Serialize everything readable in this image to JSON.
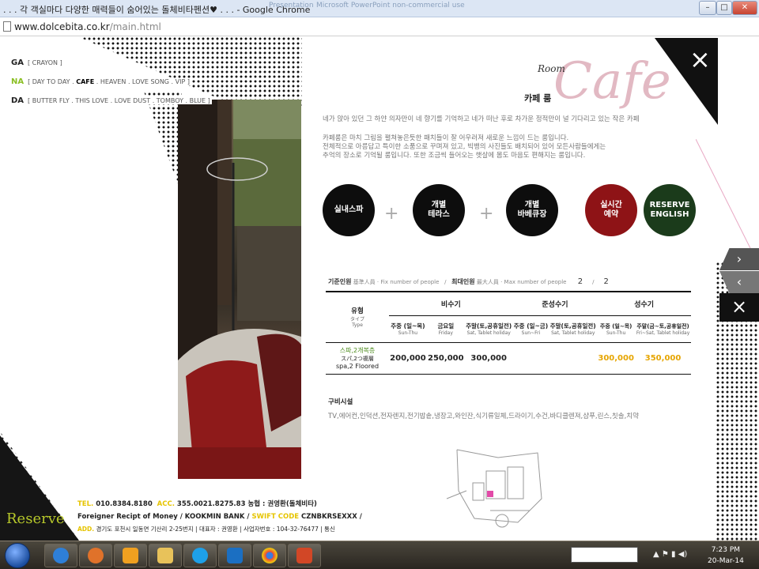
{
  "browser": {
    "title": ". . . 각 객실마다 다양한 매력들이 숨어있는 돌체비타펜션♥ . . . - Google Chrome",
    "url_host": "www.dolcebita.co.kr",
    "url_path": "/main.html",
    "window_buttons": {
      "minimize": "–",
      "maximize": "□",
      "close": "✕"
    }
  },
  "menu": [
    {
      "key": "GA",
      "items": [
        "CRAYON"
      ],
      "active": null
    },
    {
      "key": "NA",
      "items": [
        "DAY TO DAY",
        "CAFE",
        "HEAVEN",
        "LOVE SONG",
        "VIP"
      ],
      "active": "CAFE"
    },
    {
      "key": "DA",
      "items": [
        "BUTTER FLY",
        "THIS LOVE",
        "LOVE DUST",
        "TOMBOY",
        "BLUE"
      ],
      "active": null
    }
  ],
  "room": {
    "room_label": "Room",
    "script_title": "Cafe",
    "korean_title": "카페 룸",
    "close_icon": "×",
    "description_1": "네가 앉아 있던 그 하얀 의자만이 네 향기를 기억하고 네가 떠난 후로 차가운 정적만이 널 기다리고 있는 작은 카페",
    "description_2": [
      "카페룸은 마치 그림을 펼쳐놓은듯한 패치들이 잘 어우러져 새로운 느낌이 드는 룸입니다.",
      "전체적으로 아름답고 특이한 소품으로 꾸며져 있고, 빅뱅의 사진들도 배치되어 있어 모든사람들에게는",
      "추억의 장소로 기억될 룸입니다. 또한 조금씩 들어오는 햇살에 몸도 마음도 편해지는 룸입니다."
    ],
    "features": [
      {
        "label": "실내스파"
      },
      {
        "label": "개별\n테라스"
      },
      {
        "label": "개별\n바베큐장"
      }
    ],
    "buttons": {
      "realtime": "실시간\n예약",
      "reserve_en": "RESERVE\nENGLISH"
    }
  },
  "capacity": {
    "base_label": "기준인원",
    "base_sub": "基準人員 · Fix number of people",
    "max_label": "최대인원",
    "max_sub": "最大人員 · Max number of people",
    "base": "2",
    "max": "2",
    "sep": "/"
  },
  "rates": {
    "type_label": "유형",
    "type_sub1": "タイプ",
    "type_sub2": "Type",
    "seasons": [
      {
        "name": "비수기",
        "highlight": false
      },
      {
        "name": "준성수기",
        "highlight": false
      },
      {
        "name": "성수기",
        "highlight": false
      }
    ],
    "day_headers": [
      {
        "ko": "주중 (일~목)",
        "en": "Sun-Thu"
      },
      {
        "ko": "금요일",
        "en": "Friday"
      },
      {
        "ko": "주말(토,공휴일전)",
        "en": "Sat, Tablet holiday"
      },
      {
        "ko": "주중 (일~금)",
        "en": "Sun~Fri"
      },
      {
        "ko": "주말(토,공휴일전)",
        "en": "Sat, Tablet holiday"
      },
      {
        "ko": "주중 (일~목)",
        "en": "Sun-Thu"
      },
      {
        "ko": "주말(금~토,공휴일전)",
        "en": "Fri~Sat, Tablet holiday"
      }
    ],
    "room_type": {
      "ko": "스파,2개복층",
      "jp": "スパ,2つ複層",
      "en": "spa,2 Floored"
    },
    "prices": [
      "200,000",
      "250,000",
      "300,000",
      "",
      "",
      "300,000",
      "350,000"
    ],
    "highlight_color": "#e6a500"
  },
  "amenities": {
    "title": "구비시설",
    "list": "TV,에어컨,인덕션,전자렌지,전기밥솥,냉장고,와인잔,식기류일체,드라이기,수건,바디클렌져,샴푸,린스,칫솔,치약"
  },
  "footer": {
    "tel_label": "TEL.",
    "tel": "010.8384.8180",
    "acc_label": "ACC.",
    "acc": "355.0021.8275.83 농협 : 권영환(돌체비타)",
    "foreign": "Foreigner Recipt of Money / KOOKMIN BANK /",
    "swift_label": "SWIFT CODE",
    "swift": "CZNBKRSEXXX /",
    "addr_label": "ADD.",
    "addr": "경기도 포천시 일동면 기산리 2-25번지 | 대표자 : 권영환 | 사업자번호 : 104-32-76477 | 통신"
  },
  "reserve_logo": "Reserve",
  "nav": {
    "next": "›",
    "prev": "‹",
    "close": "×"
  },
  "taskbar": {
    "time": "7:23 PM",
    "date": "20-Mar-14",
    "apps": [
      "ie-icon",
      "firefox-icon",
      "media-player-icon",
      "explorer-icon",
      "skype-icon",
      "celcom-icon",
      "chrome-icon",
      "powerpoint-icon"
    ]
  }
}
